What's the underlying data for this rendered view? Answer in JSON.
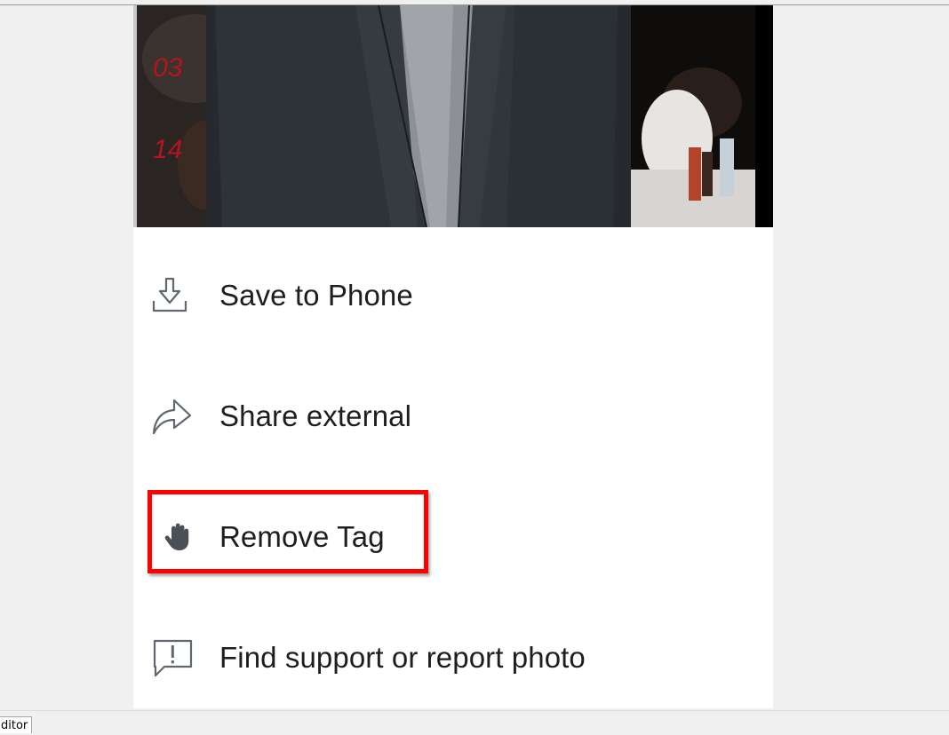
{
  "photo": {
    "overlay_numbers": [
      "03",
      "14"
    ]
  },
  "menu": {
    "items": [
      {
        "label": "Save to Phone",
        "icon": "download-icon"
      },
      {
        "label": "Share external",
        "icon": "share-arrow-icon"
      },
      {
        "label": "Remove Tag",
        "icon": "hand-stop-icon"
      },
      {
        "label": "Find support or report photo",
        "icon": "report-speech-bubble-icon"
      }
    ]
  },
  "highlight": {
    "target": "Remove Tag",
    "color": "#ff0000"
  },
  "taskbar": {
    "tab_label": "ditor"
  }
}
